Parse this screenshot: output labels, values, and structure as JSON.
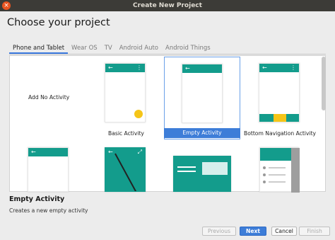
{
  "window": {
    "title": "Create New Project",
    "close_glyph": "×"
  },
  "page": {
    "heading": "Choose your project"
  },
  "tabs": [
    {
      "label": "Phone and Tablet",
      "active": true
    },
    {
      "label": "Wear OS",
      "active": false
    },
    {
      "label": "TV",
      "active": false
    },
    {
      "label": "Android Auto",
      "active": false
    },
    {
      "label": "Android Things",
      "active": false
    }
  ],
  "templates": [
    {
      "label": "Add No Activity"
    },
    {
      "label": "Basic Activity"
    },
    {
      "label": "Empty Activity",
      "selected": true
    },
    {
      "label": "Bottom Navigation Activity"
    }
  ],
  "glyphs": {
    "back_arrow": "←",
    "more_dots": "⋮",
    "expand": "⤢"
  },
  "colors": {
    "accent": "#3d7dd8",
    "teal": "#139c8c",
    "fab": "#f5c518"
  },
  "details": {
    "title": "Empty Activity",
    "description": "Creates a new empty activity"
  },
  "buttons": {
    "previous": "Previous",
    "next": "Next",
    "cancel": "Cancel",
    "finish": "Finish"
  }
}
